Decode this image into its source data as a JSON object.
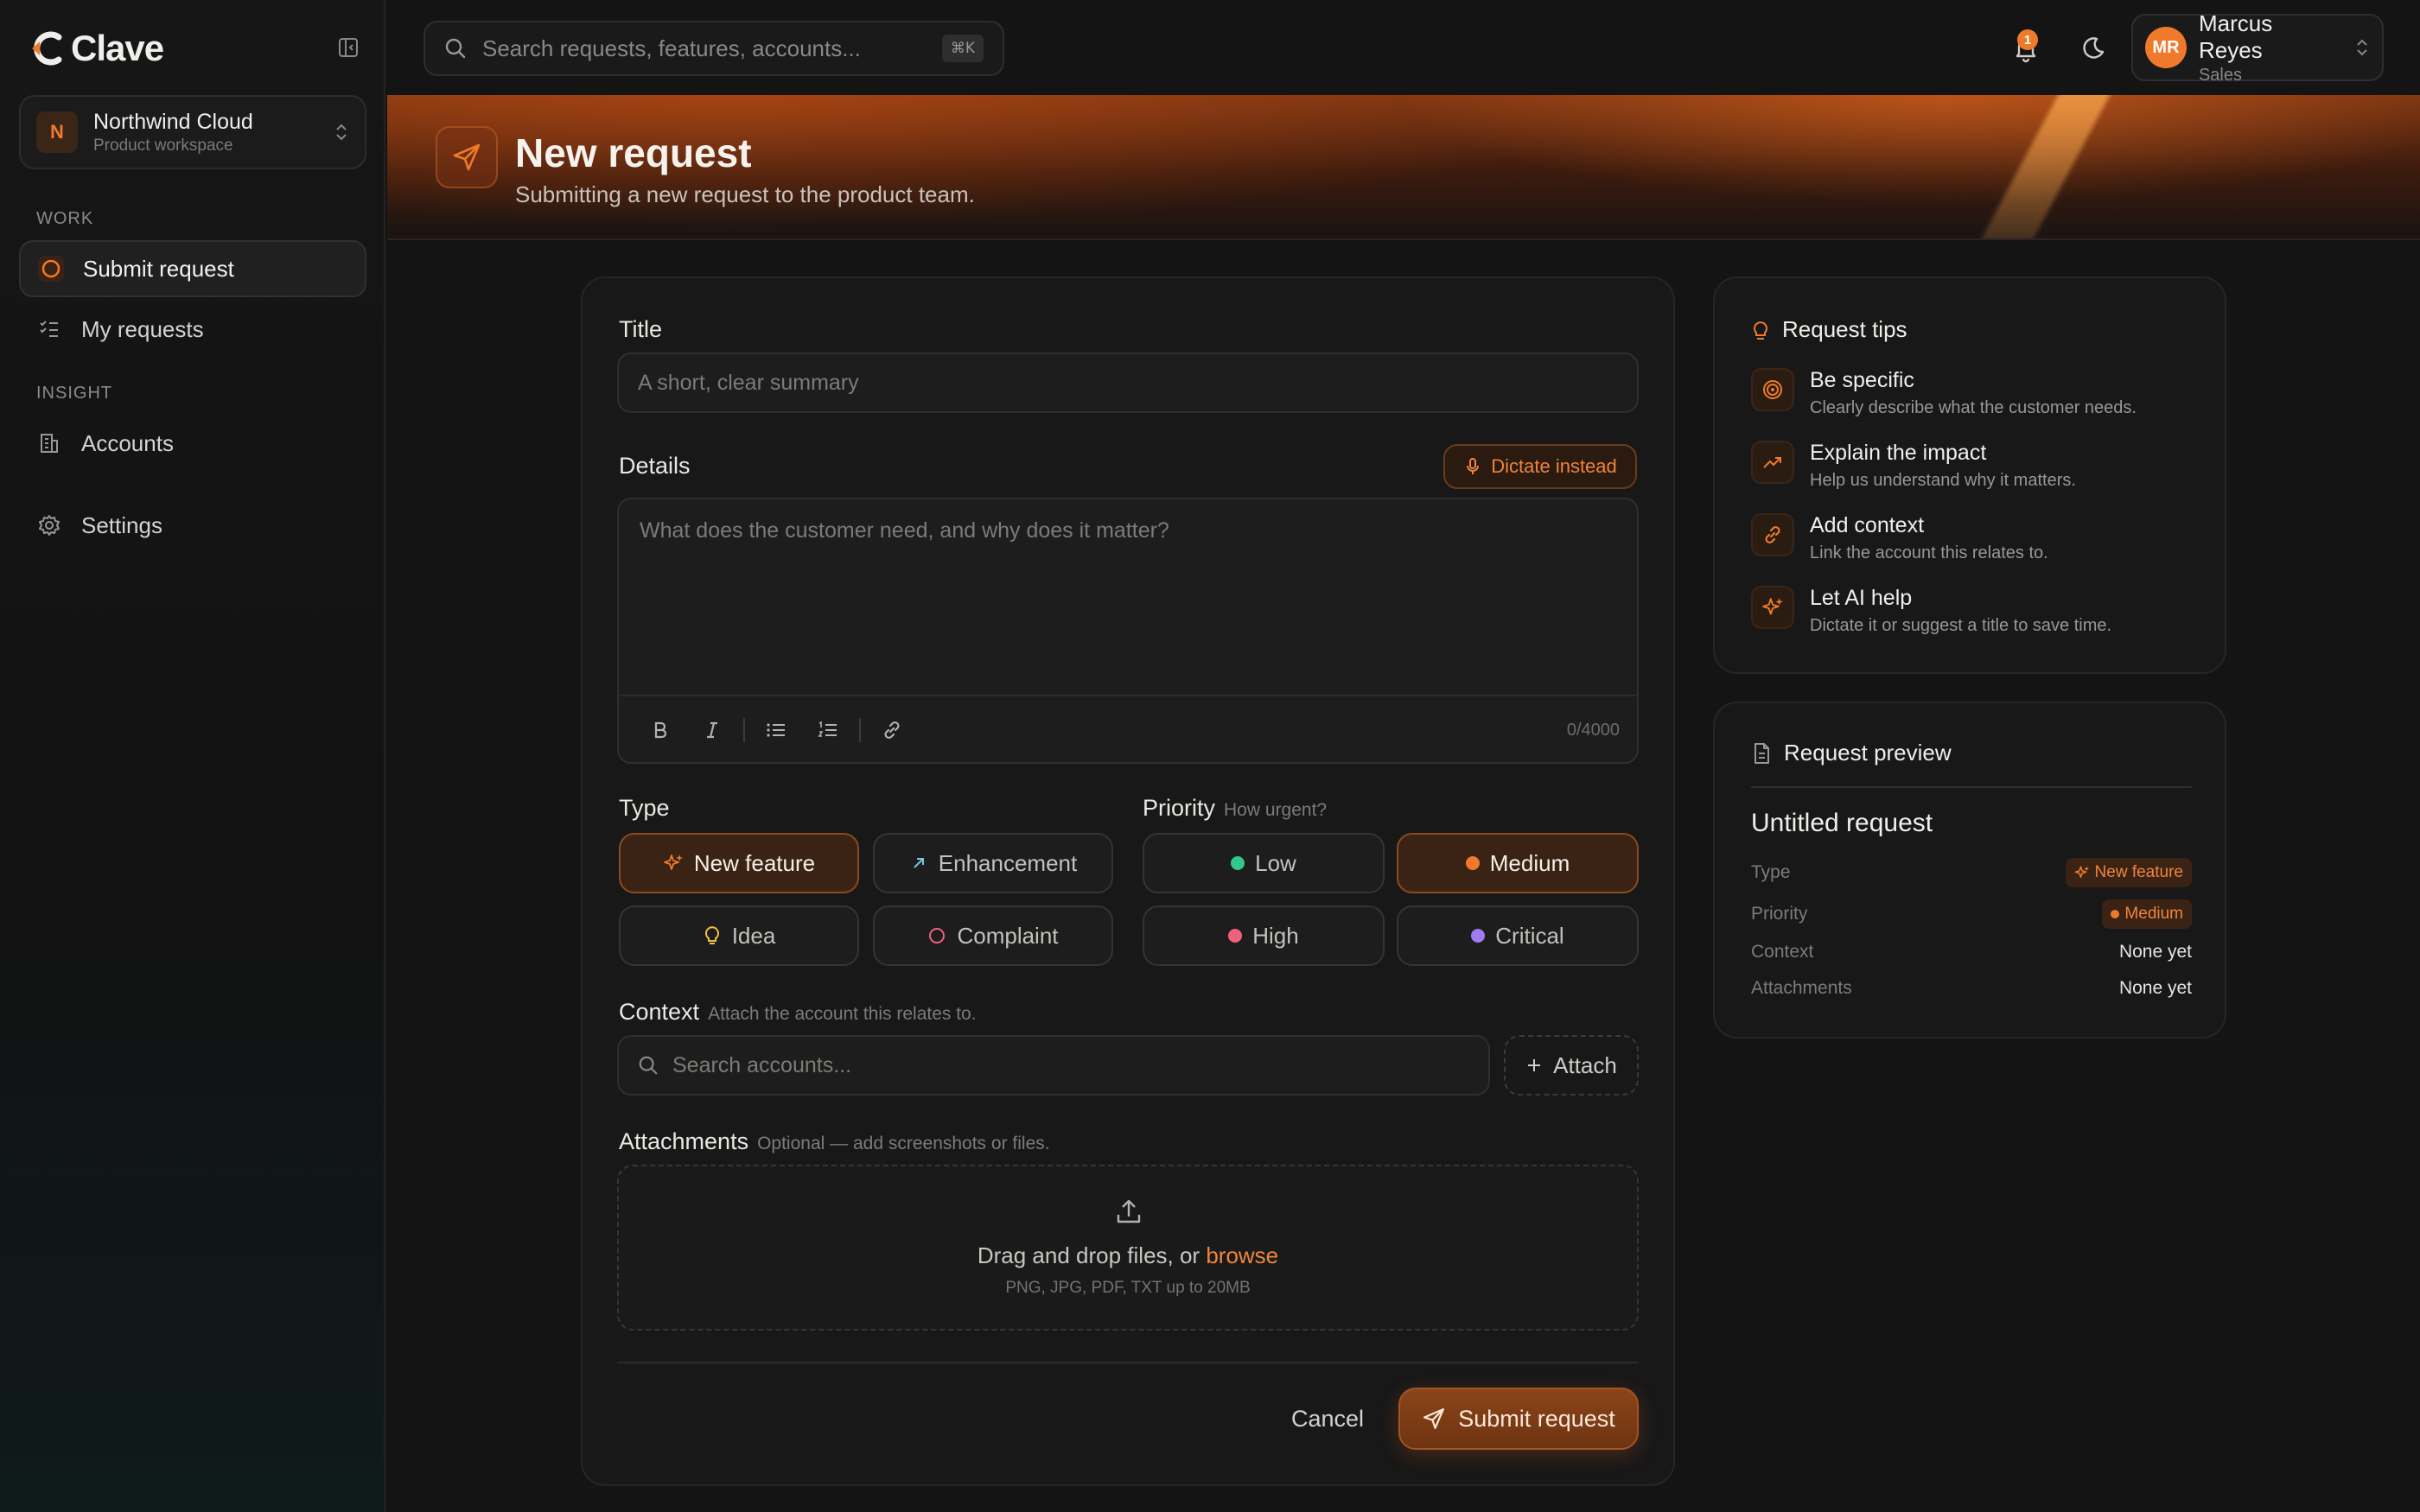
{
  "app": {
    "name": "Clave"
  },
  "workspace": {
    "initial": "N",
    "name": "Northwind Cloud",
    "subtitle": "Product workspace"
  },
  "sidebar": {
    "sections": [
      {
        "label": "WORK",
        "items": [
          {
            "label": "Submit request",
            "icon": "circle-icon",
            "active": true
          },
          {
            "label": "My requests",
            "icon": "list-check-icon"
          }
        ]
      },
      {
        "label": "INSIGHT",
        "items": [
          {
            "label": "Accounts",
            "icon": "building-icon"
          }
        ]
      }
    ],
    "settings": {
      "label": "Settings",
      "icon": "gear-icon"
    }
  },
  "topbar": {
    "search_placeholder": "Search requests, features, accounts...",
    "shortcut": "⌘K",
    "notification_count": "1",
    "user": {
      "initials": "MR",
      "name": "Marcus Reyes",
      "role": "Sales"
    }
  },
  "banner": {
    "title": "New request",
    "subtitle": "Submitting a new request to the product team."
  },
  "form": {
    "title_label": "Title",
    "title_placeholder": "A short, clear summary",
    "details_label": "Details",
    "dictate_label": "Dictate instead",
    "details_placeholder": "What does the customer need, and why does it matter?",
    "char_count": "0/4000",
    "type_label": "Type",
    "types": [
      {
        "label": "New feature",
        "icon": "sparkle-icon",
        "selected": true
      },
      {
        "label": "Enhancement",
        "icon": "arrow-up-right-icon",
        "selected": false
      },
      {
        "label": "Idea",
        "icon": "lightbulb-icon",
        "selected": false
      },
      {
        "label": "Complaint",
        "icon": "circle-outline-icon",
        "selected": false
      }
    ],
    "priority_label": "Priority",
    "priority_hint": "How urgent?",
    "priorities": [
      {
        "label": "Low",
        "color": "#2fc98a",
        "selected": false
      },
      {
        "label": "Medium",
        "color": "#f07a2b",
        "selected": true
      },
      {
        "label": "High",
        "color": "#f0607a",
        "selected": false
      },
      {
        "label": "Critical",
        "color": "#a07af0",
        "selected": false
      }
    ],
    "context_label": "Context",
    "context_hint": "Attach the account this relates to.",
    "context_placeholder": "Search accounts...",
    "attach_label": "Attach",
    "attachments_label": "Attachments",
    "attachments_hint": "Optional — add screenshots or files.",
    "dropzone_text": "Drag and drop files, or",
    "dropzone_link": "browse",
    "dropzone_sub": "PNG, JPG, PDF, TXT up to 20MB",
    "cancel_label": "Cancel",
    "submit_label": "Submit request"
  },
  "tips": {
    "title": "Request tips",
    "items": [
      {
        "title": "Be specific",
        "desc": "Clearly describe what the customer needs.",
        "icon": "target-icon"
      },
      {
        "title": "Explain the impact",
        "desc": "Help us understand why it matters.",
        "icon": "trending-up-icon"
      },
      {
        "title": "Add context",
        "desc": "Link the account this relates to.",
        "icon": "link-icon"
      },
      {
        "title": "Let AI help",
        "desc": "Dictate it or suggest a title to save time.",
        "icon": "sparkle-icon"
      }
    ]
  },
  "preview": {
    "title": "Request preview",
    "request_title": "Untitled request",
    "rows": [
      {
        "label": "Type",
        "value": "New feature"
      },
      {
        "label": "Priority",
        "value": "Medium"
      },
      {
        "label": "Context",
        "value": "None yet"
      },
      {
        "label": "Attachments",
        "value": "None yet"
      }
    ]
  },
  "colors": {
    "accent": "#f07a2b",
    "background": "#141414",
    "card": "#181818"
  }
}
